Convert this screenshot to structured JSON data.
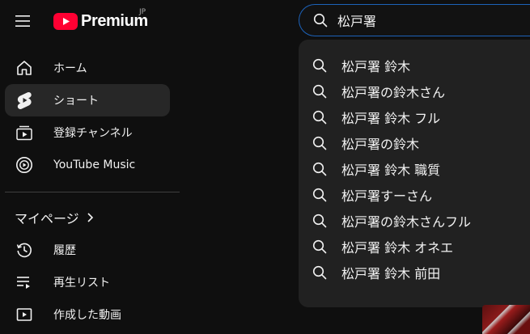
{
  "header": {
    "logo_text": "Premium",
    "region": "JP"
  },
  "search": {
    "value": "松戸署"
  },
  "suggestions": [
    "松戸署 鈴木",
    "松戸署の鈴木さん",
    "松戸署 鈴木 フル",
    "松戸署の鈴木",
    "松戸署 鈴木 職質",
    "松戸署すーさん",
    "松戸署の鈴木さんフル",
    "松戸署 鈴木 オネエ",
    "松戸署 鈴木 前田"
  ],
  "sidebar": {
    "primary": [
      {
        "label": "ホーム",
        "icon": "home-icon"
      },
      {
        "label": "ショート",
        "icon": "shorts-icon",
        "active": true
      },
      {
        "label": "登録チャンネル",
        "icon": "subscriptions-icon"
      },
      {
        "label": "YouTube Music",
        "icon": "youtube-music-icon"
      }
    ],
    "you_heading": "マイページ",
    "you": [
      {
        "label": "履歴",
        "icon": "history-icon"
      },
      {
        "label": "再生リスト",
        "icon": "playlists-icon"
      },
      {
        "label": "作成した動画",
        "icon": "your-videos-icon"
      }
    ]
  },
  "colors": {
    "background": "#0f0f0f",
    "dropdown": "#212121",
    "active_item": "#272727",
    "search_focus_border": "#1c62b9",
    "brand_red": "#ff0033"
  }
}
